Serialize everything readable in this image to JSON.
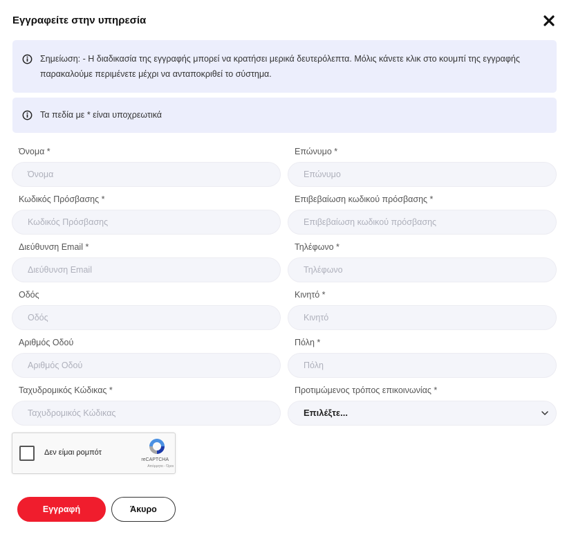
{
  "header": {
    "title": "Εγγραφείτε στην υπηρεσία"
  },
  "notices": {
    "first": "Σημείωση: - Η διαδικασία της εγγραφής μπορεί να κρατήσει μερικά δευτερόλεπτα. Μόλις κάνετε κλικ στο κουμπί της εγγραφής παρακαλούμε περιμένετε μέχρι να ανταποκριθεί το σύστημα.",
    "second": "Τα πεδία με * είναι υποχρεωτικά"
  },
  "fields": {
    "first_name": {
      "label": "Όνομα *",
      "placeholder": "Όνομα"
    },
    "last_name": {
      "label": "Επώνυμο *",
      "placeholder": "Επώνυμο"
    },
    "password": {
      "label": "Κωδικός Πρόσβασης *",
      "placeholder": "Κωδικός Πρόσβασης"
    },
    "password_confirm": {
      "label": "Επιβεβαίωση κωδικού πρόσβασης *",
      "placeholder": "Επιβεβαίωση κωδικού πρόσβασης"
    },
    "email": {
      "label": "Διεύθυνση Email *",
      "placeholder": "Διεύθυνση Email"
    },
    "phone": {
      "label": "Τηλέφωνο *",
      "placeholder": "Τηλέφωνο"
    },
    "street": {
      "label": "Οδός",
      "placeholder": "Οδός"
    },
    "mobile": {
      "label": "Κινητό *",
      "placeholder": "Κινητό"
    },
    "street_number": {
      "label": "Αριθμός Οδού",
      "placeholder": "Αριθμός Οδού"
    },
    "city": {
      "label": "Πόλη *",
      "placeholder": "Πόλη"
    },
    "postal_code": {
      "label": "Ταχυδρομικός Κώδικας *",
      "placeholder": "Ταχυδρομικός Κώδικας"
    },
    "contact_method": {
      "label": "Προτιμώμενος τρόπος επικοινωνίας *",
      "selected": "Επιλέξτε..."
    }
  },
  "captcha": {
    "label": "Δεν είμαι ρομπότ",
    "brand": "reCAPTCHA",
    "terms": "Απόρρητο - Όροι",
    "checked": false
  },
  "buttons": {
    "submit": "Εγγραφή",
    "cancel": "Άκυρο"
  },
  "icons": {
    "close": "close-icon",
    "info": "info-icon",
    "chevron": "chevron-down-icon",
    "recaptcha": "recaptcha-logo-icon"
  },
  "colors": {
    "primary": "#f01d2d",
    "notice_bg": "#eceefc",
    "input_bg": "#f4f5fa"
  }
}
